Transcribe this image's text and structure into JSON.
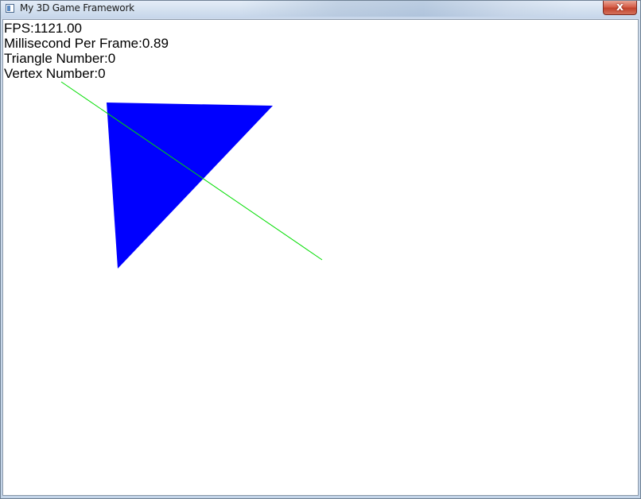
{
  "window": {
    "title": "My 3D Game Framework",
    "close_glyph": "x",
    "icon": "app-window-icon"
  },
  "stats": {
    "fps": "FPS:1121.00",
    "ms_per_frame": "Millisecond Per Frame:0.89",
    "triangle_number": "Triangle Number:0",
    "vertex_number": "Vertex Number:0"
  },
  "scene": {
    "background_color": "#ffffff",
    "triangle_color": "#0000ff",
    "line_color": "#00dd00"
  }
}
